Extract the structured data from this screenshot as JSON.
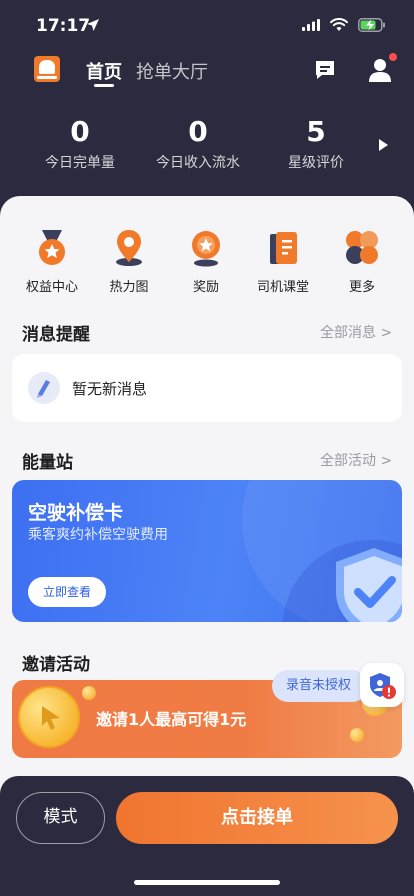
{
  "status_bar": {
    "time": "17:17"
  },
  "header": {
    "tabs": [
      {
        "label": "首页",
        "active": true
      },
      {
        "label": "抢单大厅",
        "active": false
      }
    ]
  },
  "stats": [
    {
      "value": "0",
      "label": "今日完单量"
    },
    {
      "value": "0",
      "label": "今日收入流水"
    },
    {
      "value": "5",
      "label": "星级评价"
    }
  ],
  "quick_actions": [
    {
      "label": "权益中心",
      "icon": "medal-icon"
    },
    {
      "label": "热力图",
      "icon": "map-pin-icon"
    },
    {
      "label": "奖励",
      "icon": "award-icon"
    },
    {
      "label": "司机课堂",
      "icon": "book-icon"
    },
    {
      "label": "更多",
      "icon": "more-icon"
    }
  ],
  "messages": {
    "title": "消息提醒",
    "link": "全部消息 >",
    "empty_text": "暂无新消息"
  },
  "energy": {
    "title": "能量站",
    "link": "全部活动 >",
    "card": {
      "title": "空驶补偿卡",
      "subtitle": "乘客爽约补偿空驶费用",
      "button": "立即查看"
    }
  },
  "invite": {
    "title": "邀请活动",
    "banner_text": "邀请1人最高可得1元"
  },
  "recording_pill": "录音未授权",
  "bottom": {
    "mode_label": "模式",
    "accept_label": "点击接单"
  },
  "colors": {
    "dark_bg": "#2b2a3f",
    "accent_orange": "#f0752f",
    "promo_blue": "#3d6ff2"
  }
}
